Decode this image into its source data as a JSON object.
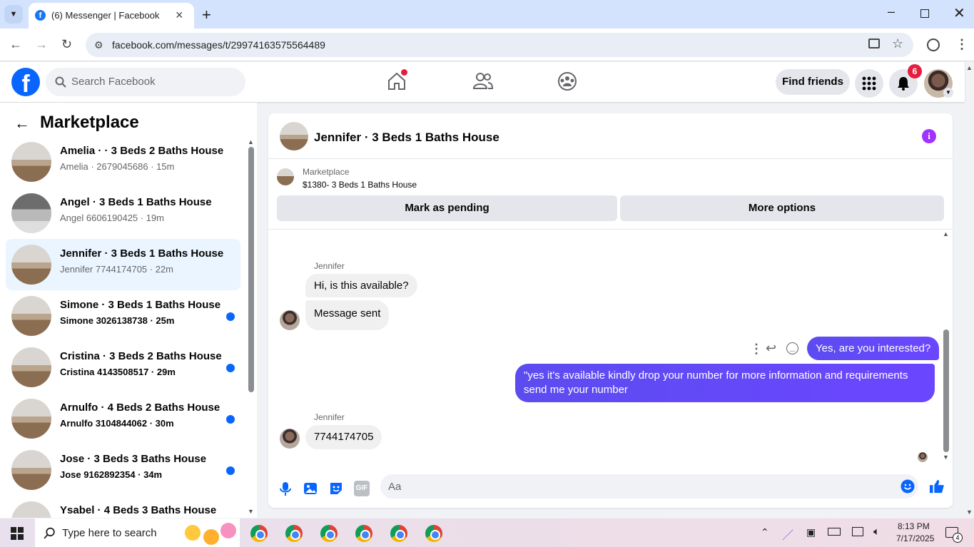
{
  "browser": {
    "tab_title": "(6) Messenger | Facebook",
    "url": "facebook.com/messages/t/29974163575564489"
  },
  "fb_header": {
    "search_placeholder": "Search Facebook",
    "find_friends": "Find friends",
    "notification_count": "6"
  },
  "left_panel": {
    "title": "Marketplace",
    "conversations": [
      {
        "name": "Amelia · · 3 Beds 2 Baths House",
        "sub": "Amelia · 2679045686 · 15m",
        "unread": false
      },
      {
        "name": "Angel · 3 Beds 1 Baths House",
        "sub": "Angel 6606190425 · 19m",
        "unread": false
      },
      {
        "name": "Jennifer · 3 Beds 1 Baths House",
        "sub": "Jennifer 7744174705 · 22m",
        "unread": false
      },
      {
        "name": "Simone · 3 Beds 1 Baths House",
        "sub": "Simone 3026138738 · 25m",
        "unread": true
      },
      {
        "name": "Cristina · 3 Beds 2 Baths House",
        "sub": "Cristina 4143508517 · 29m",
        "unread": true
      },
      {
        "name": "Arnulfo · 4 Beds 2 Baths House",
        "sub": "Arnulfo 3104844062 · 30m",
        "unread": true
      },
      {
        "name": "Jose · 3 Beds 3 Baths House",
        "sub": "Jose 9162892354 · 34m",
        "unread": true
      },
      {
        "name": "Ysabel · 4 Beds 3 Baths House",
        "sub": "",
        "unread": true
      }
    ]
  },
  "chat": {
    "title": "Jennifer · 3 Beds 1 Baths House",
    "marketplace_label": "Marketplace",
    "listing": "$1380- 3 Beds 1 Baths House",
    "mark_pending": "Mark as pending",
    "more_options": "More options",
    "messages": {
      "sender1": "Jennifer",
      "msg1": "Hi, is this available?",
      "msg2": "Message sent",
      "out1": "Yes, are you interested?",
      "out2": "\"yes it's available kindly drop your number for more information and requirements send me your number",
      "sender2": "Jennifer",
      "msg3": "7744174705"
    },
    "composer_placeholder": "Aa"
  },
  "taskbar": {
    "search_placeholder": "Type here to search",
    "time": "8:13 PM",
    "date": "7/17/2025",
    "notification_count": "4"
  },
  "colors": {
    "fb_blue": "#0866ff",
    "outgoing_bubble": "#5c4cf0",
    "badge_red": "#e41e3f",
    "info_purple": "#a033ff"
  }
}
